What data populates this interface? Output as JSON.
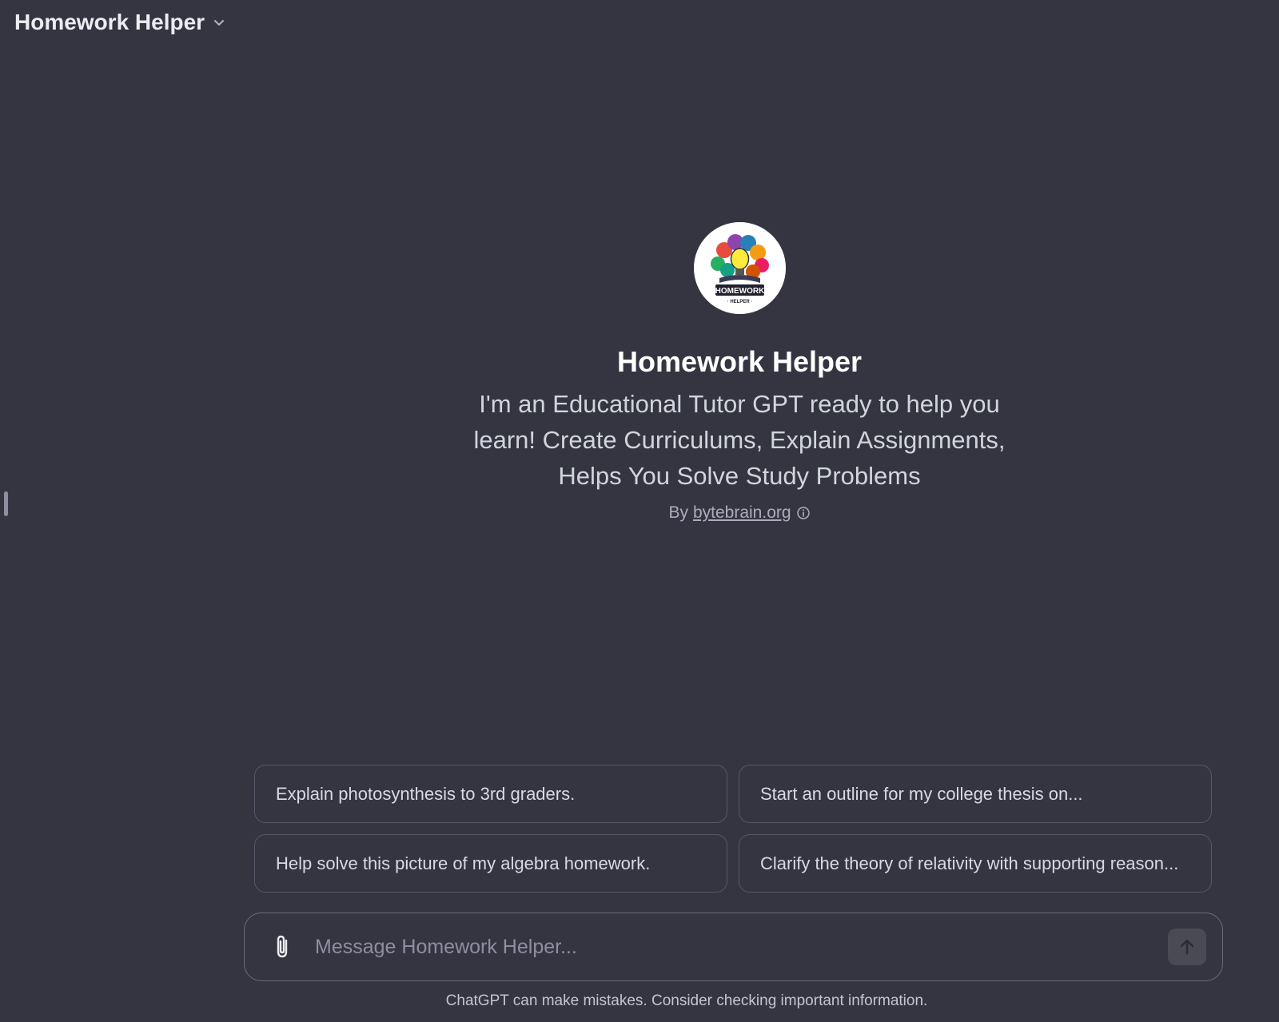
{
  "header": {
    "title": "Homework Helper",
    "dropdown_icon": "chevron-down-icon"
  },
  "gpt": {
    "logo_text_top": "HOMEWORK",
    "logo_text_bottom": "· HELPER ·",
    "name": "Homework Helper",
    "description": "I'm an Educational Tutor GPT ready to help you learn! Create Curriculums, Explain Assignments, Helps You Solve Study Problems",
    "byline_prefix": "By",
    "author": "bytebrain.org",
    "info_icon": "info-icon"
  },
  "suggestions": [
    "Explain photosynthesis to 3rd graders.",
    "Start an outline for my college thesis on...",
    "Help solve this picture of my algebra homework.",
    "Clarify the theory of relativity with supporting reason..."
  ],
  "composer": {
    "placeholder": "Message Homework Helper...",
    "attach_icon": "paperclip-icon",
    "send_icon": "arrow-up-icon"
  },
  "footer": {
    "disclaimer": "ChatGPT can make mistakes. Consider checking important information."
  },
  "colors": {
    "background": "#343541",
    "border": "#565869",
    "text_primary": "#ececf1",
    "text_secondary": "#acacbe",
    "send_button": "#494a54"
  }
}
